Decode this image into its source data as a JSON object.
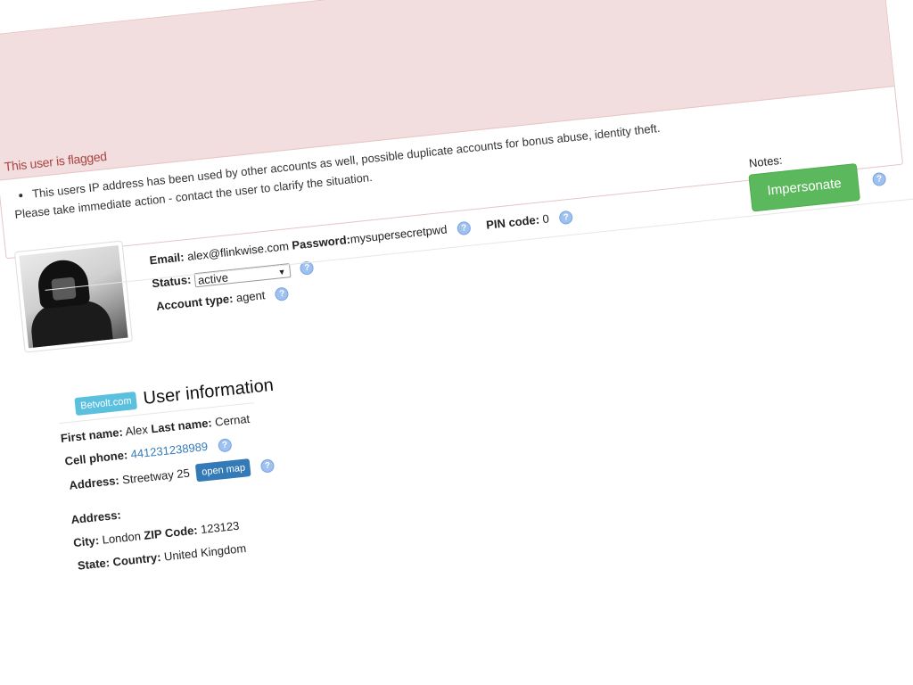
{
  "alert": {
    "title": "This user is flagged",
    "bullet": "This users IP address has been used by other accounts as well, possible duplicate accounts for bonus abuse, identity theft.",
    "action": "Please take immediate action - contact the user to clarify the situation."
  },
  "account": {
    "email_label": "Email:",
    "email_value": "alex@flinkwise.com",
    "password_label": "Password:",
    "password_value": "mysupersecretpwd",
    "pin_label": "PIN code:",
    "pin_value": "0",
    "status_label": "Status:",
    "status_value": "active",
    "type_label": "Account type:",
    "type_value": "agent"
  },
  "notes": {
    "label": "Notes:",
    "impersonate_label": "Impersonate"
  },
  "user_info": {
    "badge": "Betvolt.com",
    "title": "User information",
    "first_name_label": "First name:",
    "first_name_value": "Alex",
    "last_name_label": "Last name:",
    "last_name_value": "Cernat",
    "cell_label": "Cell phone:",
    "cell_value": "441231238989",
    "address_label": "Address:",
    "address_value": "Streetway 25",
    "open_map_label": "open map",
    "address2_label": "Address:",
    "city_label": "City:",
    "city_value": "London",
    "zip_label": "ZIP Code:",
    "zip_value": "123123",
    "state_label": "State:",
    "country_label": "Country:",
    "country_value": "United Kingdom"
  },
  "icons": {
    "help": "?",
    "dropdown": "▼"
  },
  "colors": {
    "alert_bg": "#f2dede",
    "alert_text": "#a94442",
    "success": "#5cb85c",
    "info": "#5bc0de",
    "primary": "#337ab7"
  }
}
